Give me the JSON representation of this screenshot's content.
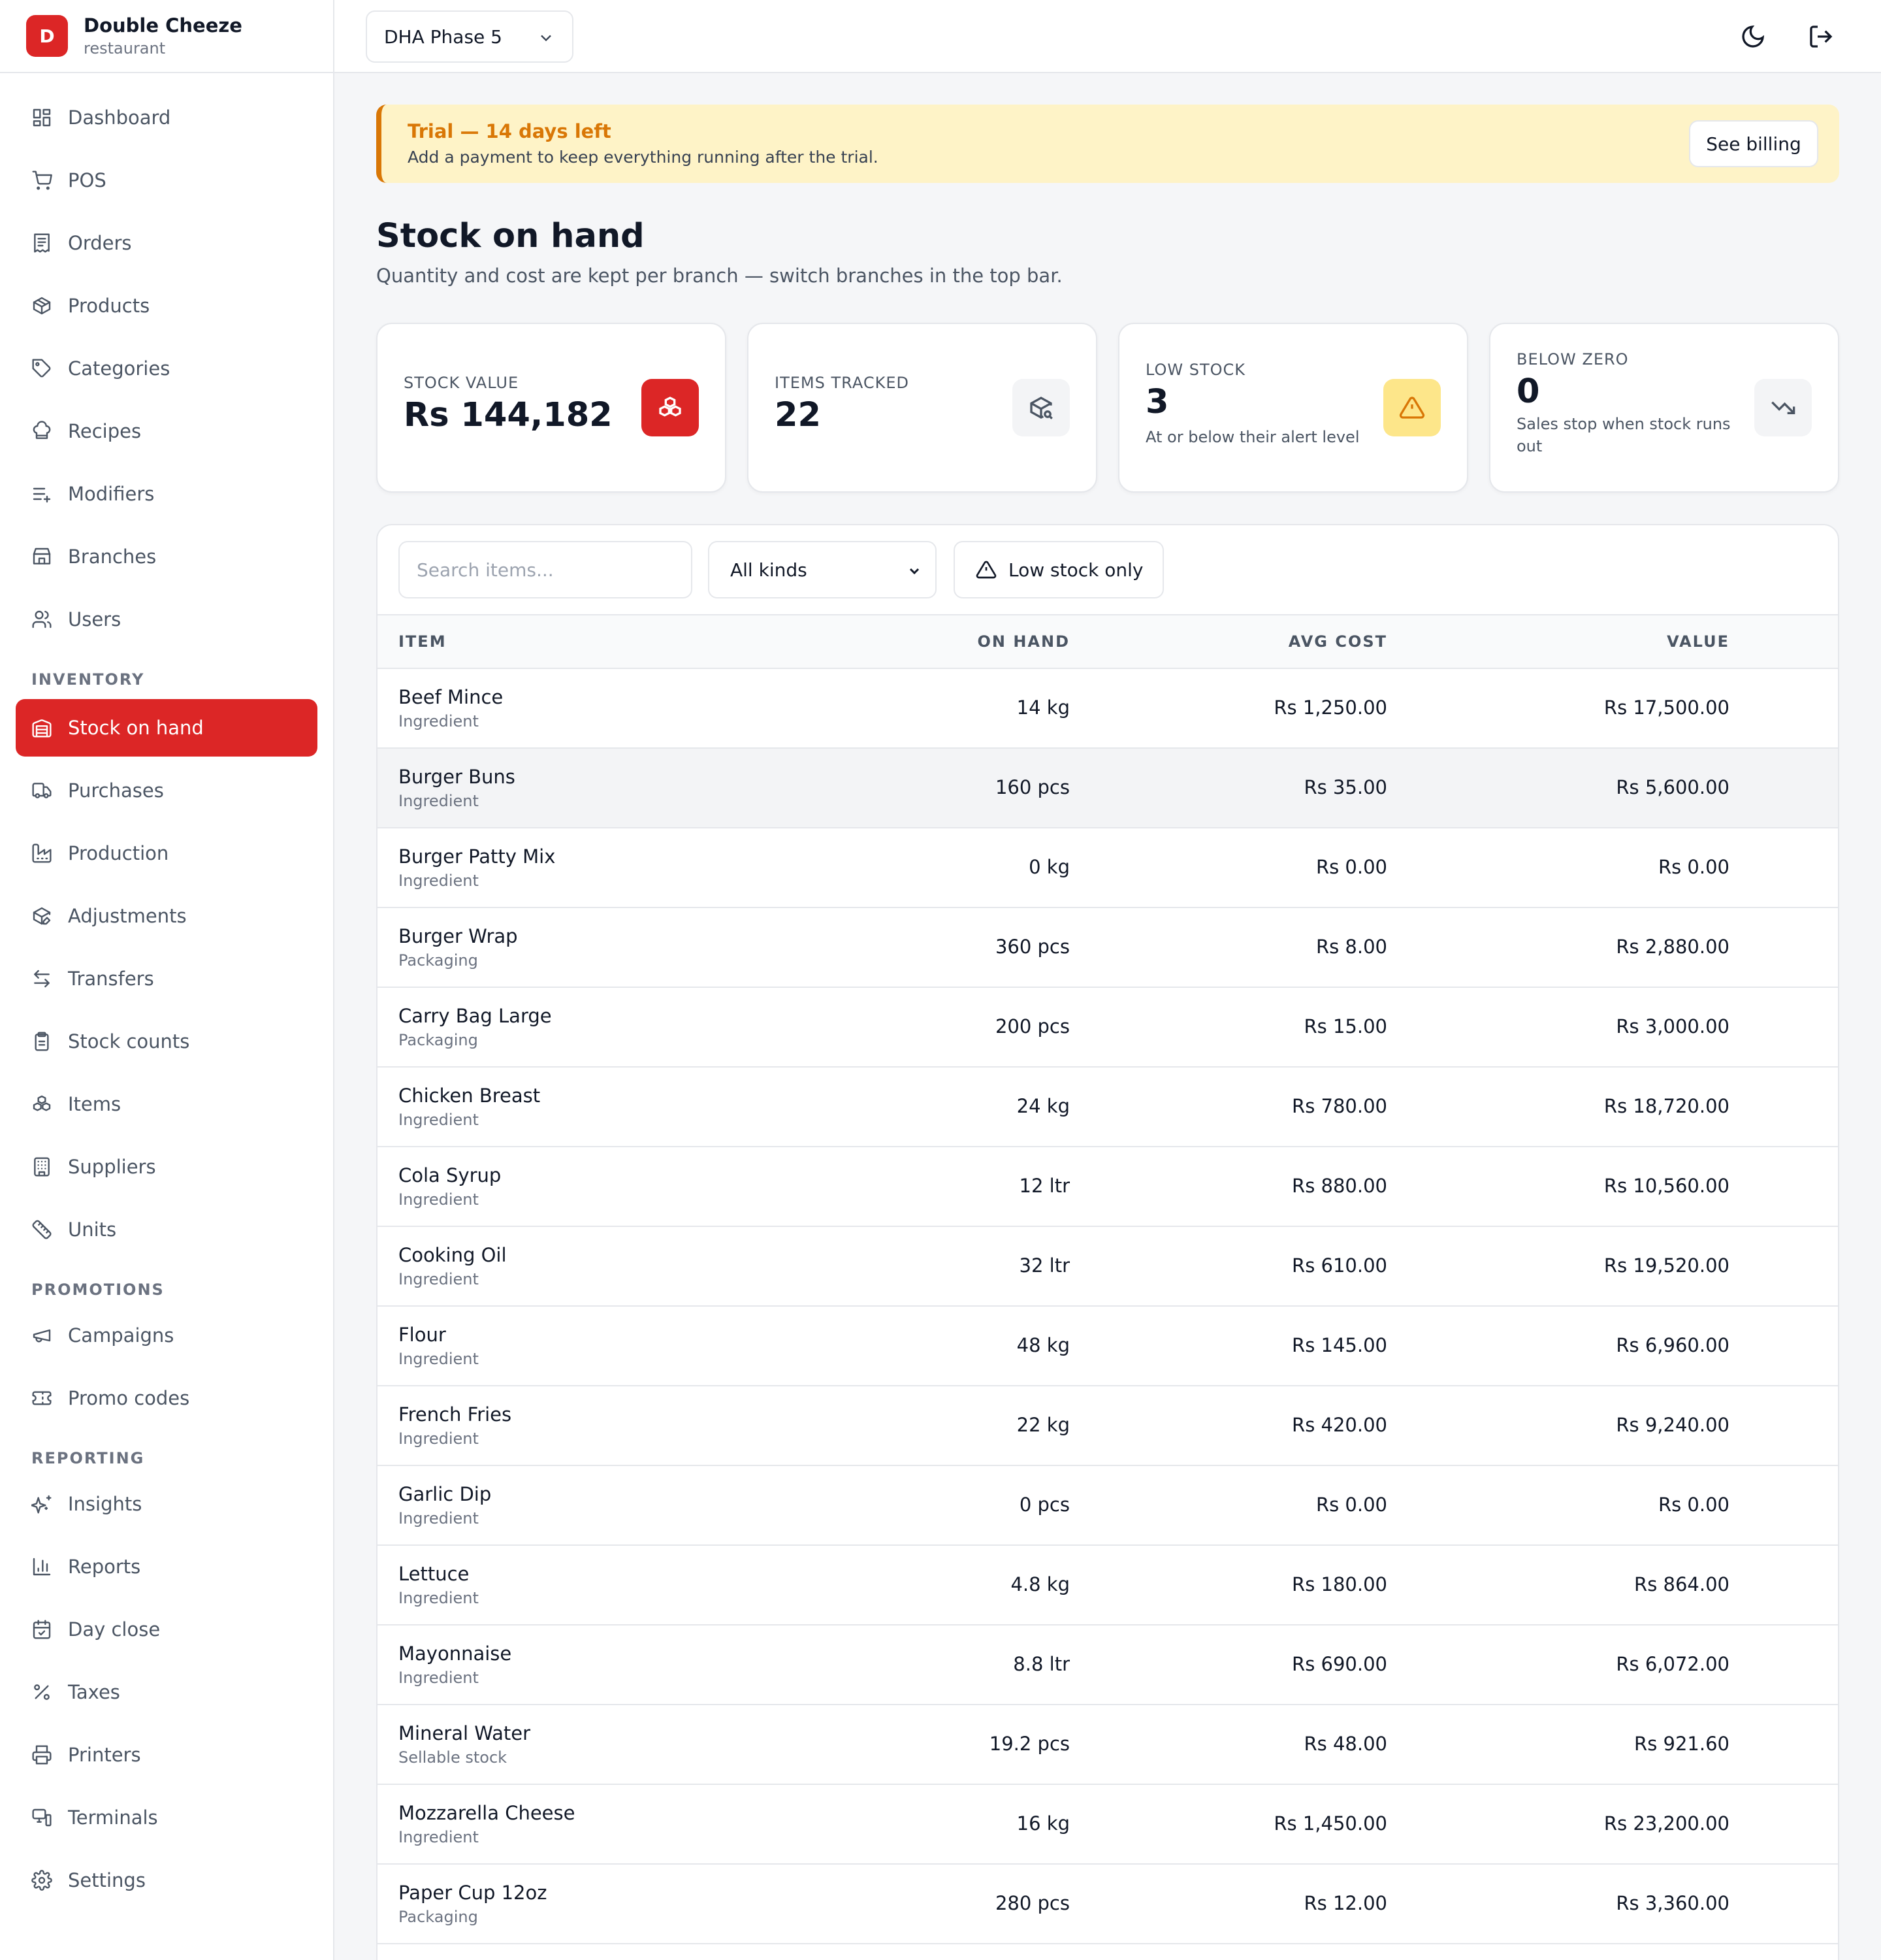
{
  "brand": {
    "initial": "D",
    "name": "Double Cheeze",
    "subtitle": "restaurant"
  },
  "nav": {
    "main": [
      {
        "label": "Dashboard",
        "icon": "dashboard-icon"
      },
      {
        "label": "POS",
        "icon": "cart-icon"
      },
      {
        "label": "Orders",
        "icon": "receipt-icon"
      },
      {
        "label": "Products",
        "icon": "package-icon"
      },
      {
        "label": "Categories",
        "icon": "tag-icon"
      },
      {
        "label": "Recipes",
        "icon": "chef-hat-icon"
      },
      {
        "label": "Modifiers",
        "icon": "list-plus-icon"
      },
      {
        "label": "Branches",
        "icon": "store-icon"
      },
      {
        "label": "Users",
        "icon": "users-icon"
      }
    ],
    "inventory_title": "INVENTORY",
    "inventory": [
      {
        "label": "Stock on hand",
        "icon": "warehouse-icon",
        "active": true
      },
      {
        "label": "Purchases",
        "icon": "truck-icon"
      },
      {
        "label": "Production",
        "icon": "factory-icon"
      },
      {
        "label": "Adjustments",
        "icon": "package-edit-icon"
      },
      {
        "label": "Transfers",
        "icon": "arrows-swap-icon"
      },
      {
        "label": "Stock counts",
        "icon": "clipboard-icon"
      },
      {
        "label": "Items",
        "icon": "boxes-icon"
      },
      {
        "label": "Suppliers",
        "icon": "building-icon"
      },
      {
        "label": "Units",
        "icon": "ruler-icon"
      }
    ],
    "promotions_title": "PROMOTIONS",
    "promotions": [
      {
        "label": "Campaigns",
        "icon": "megaphone-icon"
      },
      {
        "label": "Promo codes",
        "icon": "ticket-icon"
      }
    ],
    "reporting_title": "REPORTING",
    "reporting": [
      {
        "label": "Insights",
        "icon": "sparkles-icon"
      },
      {
        "label": "Reports",
        "icon": "bar-chart-icon"
      },
      {
        "label": "Day close",
        "icon": "calendar-check-icon"
      },
      {
        "label": "Taxes",
        "icon": "percent-icon"
      },
      {
        "label": "Printers",
        "icon": "printer-icon"
      },
      {
        "label": "Terminals",
        "icon": "monitor-icon"
      },
      {
        "label": "Settings",
        "icon": "gear-icon"
      }
    ]
  },
  "topbar": {
    "branch": "DHA Phase 5",
    "theme_icon": "moon-icon",
    "logout_icon": "logout-icon"
  },
  "trial": {
    "title": "Trial — 14 days left",
    "text": "Add a payment to keep everything running after the trial.",
    "button": "See billing"
  },
  "page": {
    "title": "Stock on hand",
    "subtitle": "Quantity and cost are kept per branch — switch branches in the top bar."
  },
  "stats": {
    "stock_value": {
      "label": "STOCK VALUE",
      "value": "Rs 144,182",
      "icon": "boxes-icon"
    },
    "items_tracked": {
      "label": "ITEMS TRACKED",
      "value": "22",
      "icon": "package-search-icon"
    },
    "low_stock": {
      "label": "LOW STOCK",
      "value": "3",
      "note": "At or below their alert level",
      "icon": "warning-icon"
    },
    "below_zero": {
      "label": "BELOW ZERO",
      "value": "0",
      "note": "Sales stop when stock runs out",
      "icon": "trending-down-icon"
    }
  },
  "filters": {
    "search_placeholder": "Search items...",
    "kind": "All kinds",
    "low_stock_button": "Low stock only"
  },
  "table": {
    "headers": {
      "item": "ITEM",
      "on_hand": "ON HAND",
      "avg_cost": "AVG COST",
      "value": "VALUE"
    },
    "rows": [
      {
        "name": "Beef Mince",
        "kind": "Ingredient",
        "on_hand": "14 kg",
        "avg_cost": "Rs 1,250.00",
        "value": "Rs 17,500.00"
      },
      {
        "name": "Burger Buns",
        "kind": "Ingredient",
        "on_hand": "160 pcs",
        "avg_cost": "Rs 35.00",
        "value": "Rs 5,600.00"
      },
      {
        "name": "Burger Patty Mix",
        "kind": "Ingredient",
        "on_hand": "0 kg",
        "avg_cost": "Rs 0.00",
        "value": "Rs 0.00"
      },
      {
        "name": "Burger Wrap",
        "kind": "Packaging",
        "on_hand": "360 pcs",
        "avg_cost": "Rs 8.00",
        "value": "Rs 2,880.00"
      },
      {
        "name": "Carry Bag Large",
        "kind": "Packaging",
        "on_hand": "200 pcs",
        "avg_cost": "Rs 15.00",
        "value": "Rs 3,000.00"
      },
      {
        "name": "Chicken Breast",
        "kind": "Ingredient",
        "on_hand": "24 kg",
        "avg_cost": "Rs 780.00",
        "value": "Rs 18,720.00"
      },
      {
        "name": "Cola Syrup",
        "kind": "Ingredient",
        "on_hand": "12 ltr",
        "avg_cost": "Rs 880.00",
        "value": "Rs 10,560.00"
      },
      {
        "name": "Cooking Oil",
        "kind": "Ingredient",
        "on_hand": "32 ltr",
        "avg_cost": "Rs 610.00",
        "value": "Rs 19,520.00"
      },
      {
        "name": "Flour",
        "kind": "Ingredient",
        "on_hand": "48 kg",
        "avg_cost": "Rs 145.00",
        "value": "Rs 6,960.00"
      },
      {
        "name": "French Fries",
        "kind": "Ingredient",
        "on_hand": "22 kg",
        "avg_cost": "Rs 420.00",
        "value": "Rs 9,240.00"
      },
      {
        "name": "Garlic Dip",
        "kind": "Ingredient",
        "on_hand": "0 pcs",
        "avg_cost": "Rs 0.00",
        "value": "Rs 0.00"
      },
      {
        "name": "Lettuce",
        "kind": "Ingredient",
        "on_hand": "4.8 kg",
        "avg_cost": "Rs 180.00",
        "value": "Rs 864.00"
      },
      {
        "name": "Mayonnaise",
        "kind": "Ingredient",
        "on_hand": "8.8 ltr",
        "avg_cost": "Rs 690.00",
        "value": "Rs 6,072.00"
      },
      {
        "name": "Mineral Water",
        "kind": "Sellable stock",
        "on_hand": "19.2 pcs",
        "avg_cost": "Rs 48.00",
        "value": "Rs 921.60"
      },
      {
        "name": "Mozzarella Cheese",
        "kind": "Ingredient",
        "on_hand": "16 kg",
        "avg_cost": "Rs 1,450.00",
        "value": "Rs 23,200.00"
      },
      {
        "name": "Paper Cup 12oz",
        "kind": "Packaging",
        "on_hand": "280 pcs",
        "avg_cost": "Rs 12.00",
        "value": "Rs 3,360.00"
      }
    ]
  },
  "colors": {
    "accent": "#dc2626",
    "warning": "#d97706",
    "trial_bg": "#fef3c7"
  }
}
